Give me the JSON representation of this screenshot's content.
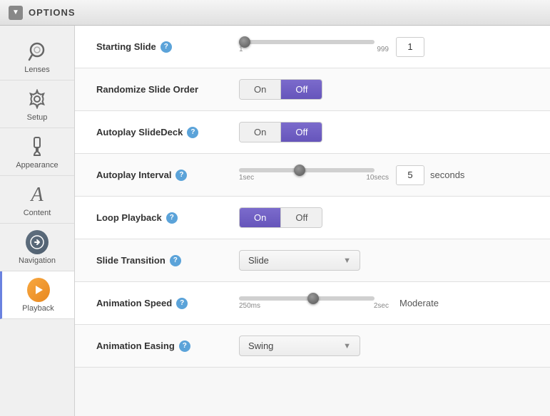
{
  "header": {
    "title": "OPTIONS",
    "chevron_label": "▼"
  },
  "sidebar": {
    "items": [
      {
        "id": "lenses",
        "label": "Lenses",
        "icon_type": "lenses",
        "active": false
      },
      {
        "id": "setup",
        "label": "Setup",
        "icon_type": "gear",
        "active": false
      },
      {
        "id": "appearance",
        "label": "Appearance",
        "icon_type": "brush",
        "active": false
      },
      {
        "id": "content",
        "label": "Content",
        "icon_type": "text",
        "active": false
      },
      {
        "id": "navigation",
        "label": "Navigation",
        "icon_type": "nav",
        "active": false
      },
      {
        "id": "playback",
        "label": "Playback",
        "icon_type": "play",
        "active": true
      }
    ]
  },
  "options": {
    "rows": [
      {
        "id": "starting-slide",
        "label": "Starting Slide",
        "has_help": true,
        "control_type": "slider_number",
        "slider_min": "1",
        "slider_max": "999",
        "slider_value": 0,
        "slider_thumb_pct": 2,
        "number_value": "1"
      },
      {
        "id": "randomize-slide-order",
        "label": "Randomize Slide Order",
        "has_help": false,
        "control_type": "toggle",
        "toggle_on_active": false,
        "toggle_off_active": true
      },
      {
        "id": "autoplay-slidedeck",
        "label": "Autoplay SlideDeck",
        "has_help": true,
        "control_type": "toggle",
        "toggle_on_active": false,
        "toggle_off_active": true
      },
      {
        "id": "autoplay-interval",
        "label": "Autoplay Interval",
        "has_help": true,
        "control_type": "slider_seconds",
        "slider_min": "1sec",
        "slider_max": "10secs",
        "slider_thumb_pct": 50,
        "number_value": "5",
        "suffix": "seconds"
      },
      {
        "id": "loop-playback",
        "label": "Loop Playback",
        "has_help": true,
        "control_type": "toggle",
        "toggle_on_active": true,
        "toggle_off_active": false
      },
      {
        "id": "slide-transition",
        "label": "Slide Transition",
        "has_help": true,
        "control_type": "dropdown",
        "dropdown_value": "Slide"
      },
      {
        "id": "animation-speed",
        "label": "Animation Speed",
        "has_help": true,
        "control_type": "slider_label",
        "slider_min": "250ms",
        "slider_max": "2sec",
        "slider_thumb_pct": 55,
        "suffix": "Moderate"
      },
      {
        "id": "animation-easing",
        "label": "Animation Easing",
        "has_help": true,
        "control_type": "dropdown",
        "dropdown_value": "Swing"
      }
    ],
    "toggle_on_label": "On",
    "toggle_off_label": "Off"
  }
}
